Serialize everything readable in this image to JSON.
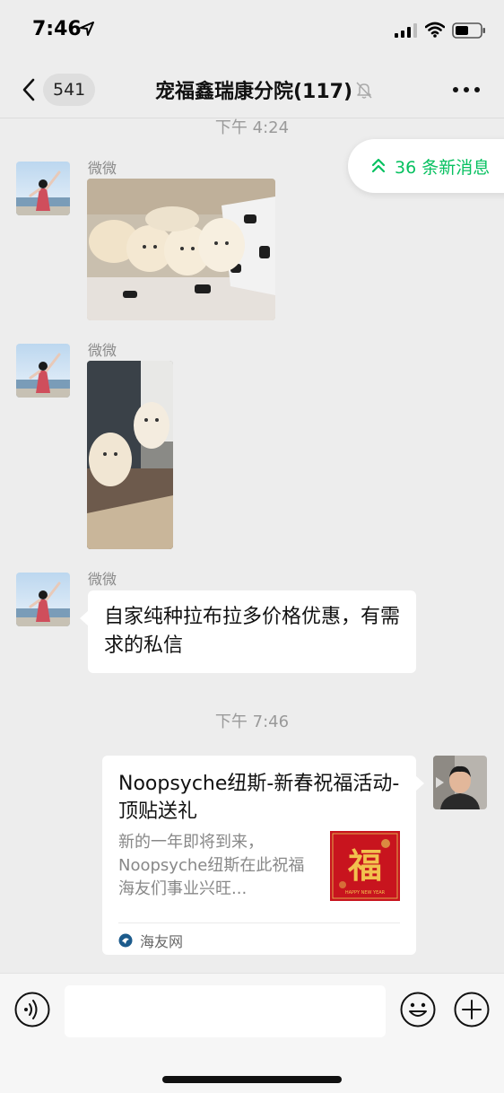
{
  "status_bar": {
    "time": "7:46"
  },
  "nav": {
    "unread_count": "541",
    "title": "宠福鑫瑞康分院(117)"
  },
  "new_messages": {
    "label": "36 条新消息"
  },
  "messages": [
    {
      "type": "time",
      "text": "下午 4:24"
    },
    {
      "type": "image",
      "sender": "微微",
      "content": "puppies-on-blanket-photo"
    },
    {
      "type": "image",
      "sender": "微微",
      "content": "two-puppies-by-door-photo"
    },
    {
      "type": "text",
      "sender": "微微",
      "text": "自家纯种拉布拉多价格优惠，有需求的私信"
    },
    {
      "type": "time",
      "text": "下午 7:46"
    },
    {
      "type": "link",
      "sender": "self",
      "title": "Noopsyche纽斯-新春祝福活动-顶贴送礼",
      "description": "新的一年即将到来，Noopsyche纽斯在此祝福海友们事业兴旺...",
      "source": "海友网",
      "thumb_char": "福",
      "thumb_caption": "HAPPY NEW YEAR"
    }
  ],
  "input": {
    "value": "",
    "placeholder": ""
  },
  "colors": {
    "accent": "#07c160",
    "background": "#ededed",
    "bubble": "#ffffff",
    "card_red": "#c8141e"
  }
}
